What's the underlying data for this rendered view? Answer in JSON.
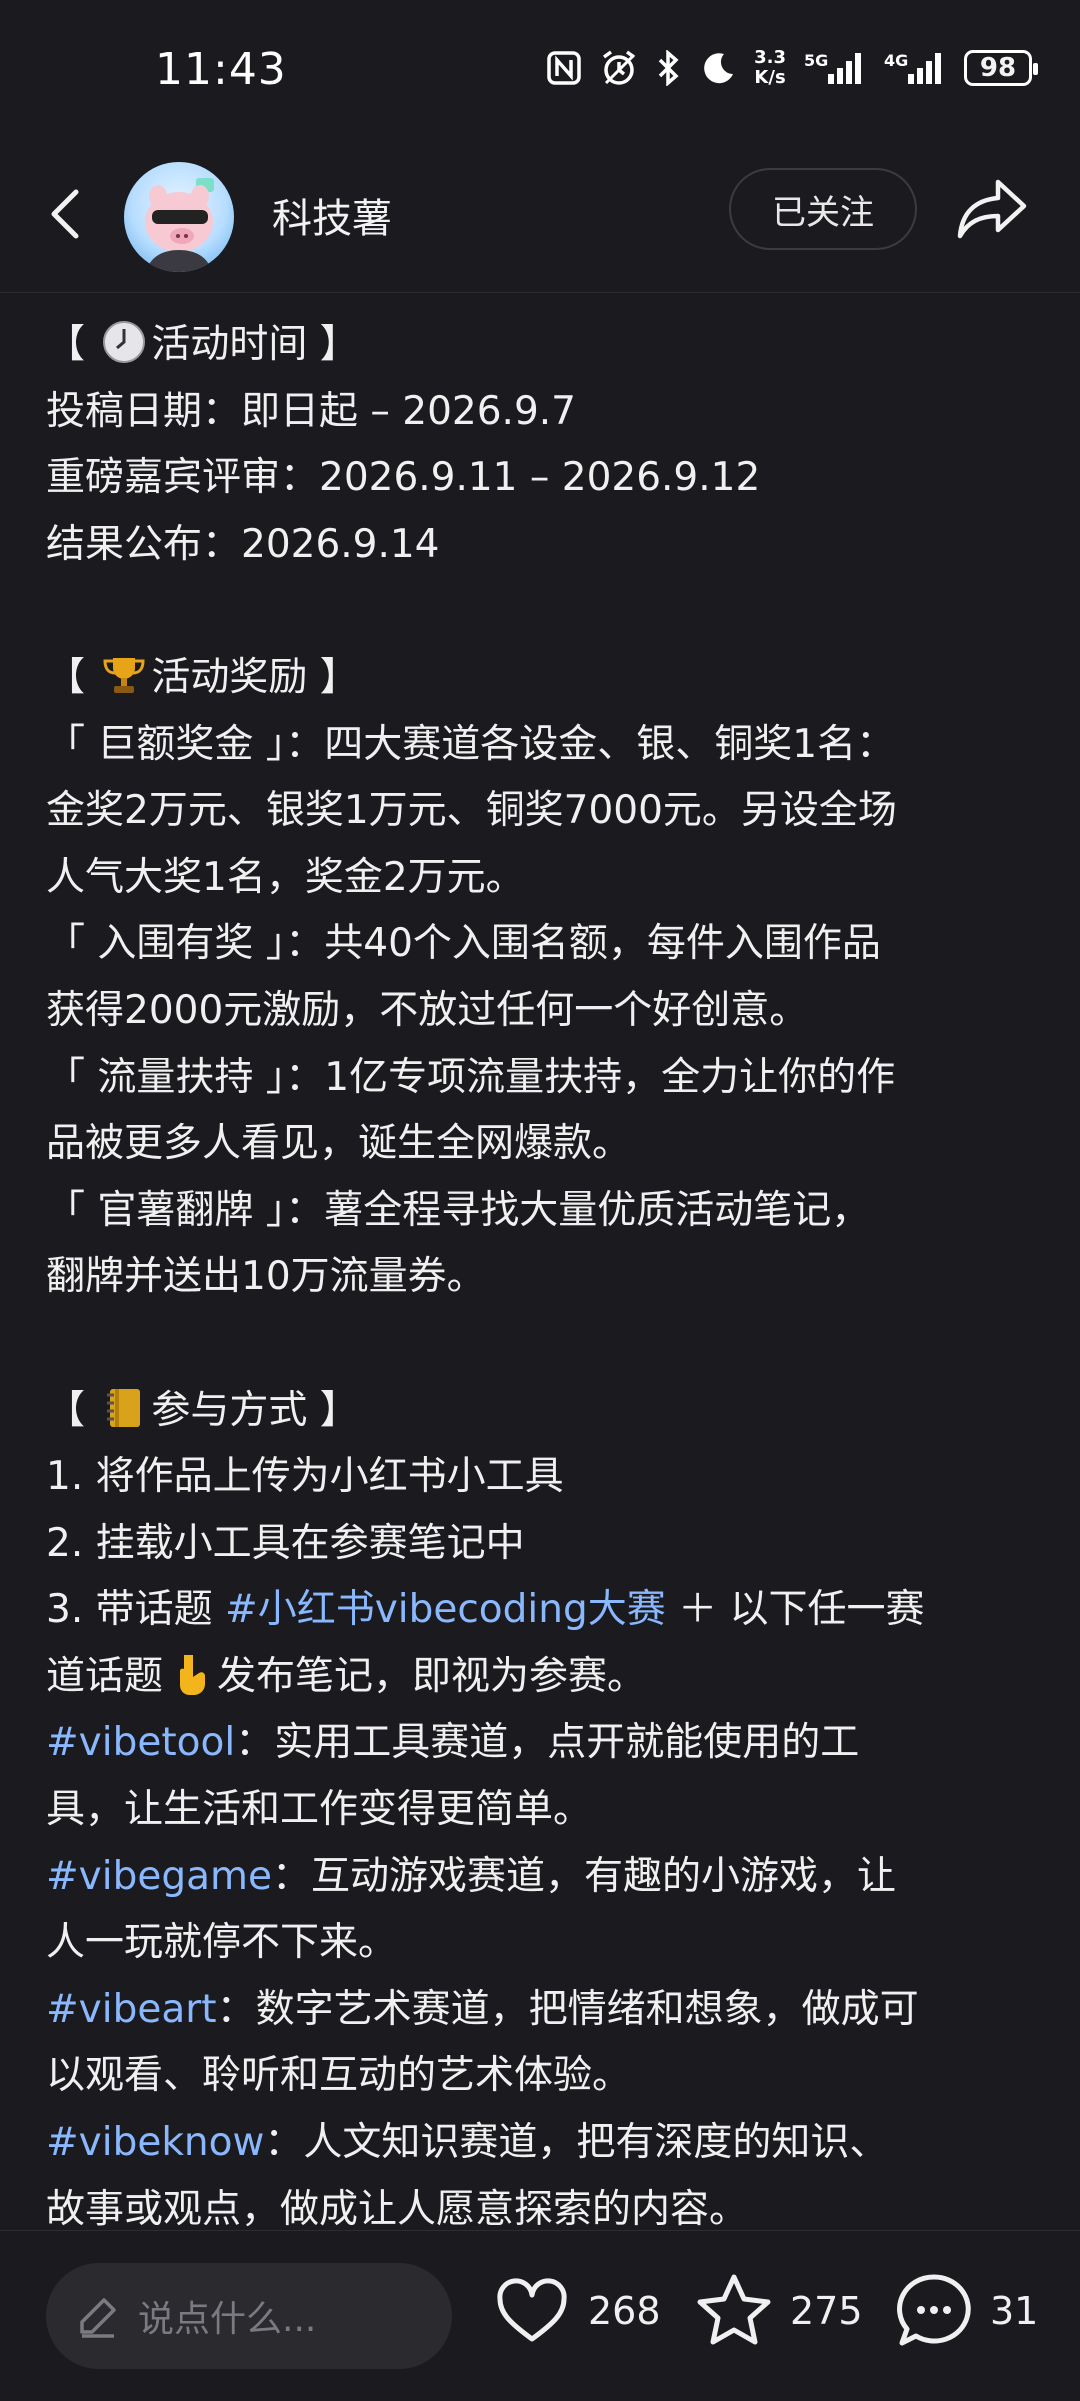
{
  "status_bar": {
    "time": "11:43",
    "icons": [
      "nfc-icon",
      "alarm-icon",
      "bluetooth-icon",
      "moon-icon",
      "network-speed",
      "5g-signal-icon",
      "4g-signal-icon",
      "battery-icon"
    ],
    "network_speed": [
      "3.3",
      "K/s"
    ],
    "signal_5g": "5G",
    "signal_4g": "4G",
    "battery": "98"
  },
  "header": {
    "author": "科技薯",
    "follow_label": "已关注"
  },
  "content": {
    "section_time": {
      "heading": [
        "【 ",
        "活动时间 】"
      ],
      "lines": [
        "投稿日期：即日起 – 2026.9.7",
        "重磅嘉宾评审：2026.9.11 – 2026.9.12",
        "结果公布：2026.9.14"
      ]
    },
    "section_rewards": {
      "heading": [
        "【 ",
        "活动奖励 】"
      ],
      "lines": [
        "「 巨额奖金 」：四大赛道各设金、银、铜奖1名：",
        "金奖2万元、银奖1万元、铜奖7000元。另设全场",
        "人气大奖1名，奖金2万元。",
        "「 入围有奖 」：共40个入围名额，每件入围作品",
        "获得2000元激励，不放过任何一个好创意。",
        "「 流量扶持 」：1亿专项流量扶持，全力让你的作",
        "品被更多人看见，诞生全网爆款。",
        "「 官薯翻牌 」：薯全程寻找大量优质活动笔记，",
        "翻牌并送出10万流量券。"
      ]
    },
    "section_join": {
      "heading": [
        "【 ",
        "参与方式 】"
      ],
      "step1": "1. 将作品上传为小红书小工具",
      "step2": "2. 挂载小工具在参赛笔记中",
      "step3_prefix": "3. 带话题 ",
      "step3_tag": "#小红书vibecoding大赛",
      "step3_suffix": " ＋ 以下任一赛",
      "step3_line2_a": "道话题",
      "step3_line2_b": "发布笔记，即视为参赛。",
      "tracks": [
        {
          "tag": "#vibetool",
          "line1": "：实用工具赛道，点开就能使用的工",
          "line2": "具，让生活和工作变得更简单。"
        },
        {
          "tag": "#vibegame",
          "line1": "：互动游戏赛道，有趣的小游戏，让",
          "line2": "人一玩就停不下来。"
        },
        {
          "tag": "#vibeart",
          "line1": "：数字艺术赛道，把情绪和想象，做成可",
          "line2": "以观看、聆听和互动的艺术体验。"
        },
        {
          "tag": "#vibeknow",
          "line1": "：人文知识赛道，把有深度的知识、",
          "line2": "故事或观点，做成让人愿意探索的内容。"
        }
      ]
    }
  },
  "bottom_bar": {
    "comment_placeholder": "说点什么...",
    "likes": "268",
    "favorites": "275",
    "comments": "31"
  },
  "colors": {
    "background": "#1b1b1f",
    "hashtag": "#8ab8ff",
    "input_bg": "#2a2a2f"
  }
}
